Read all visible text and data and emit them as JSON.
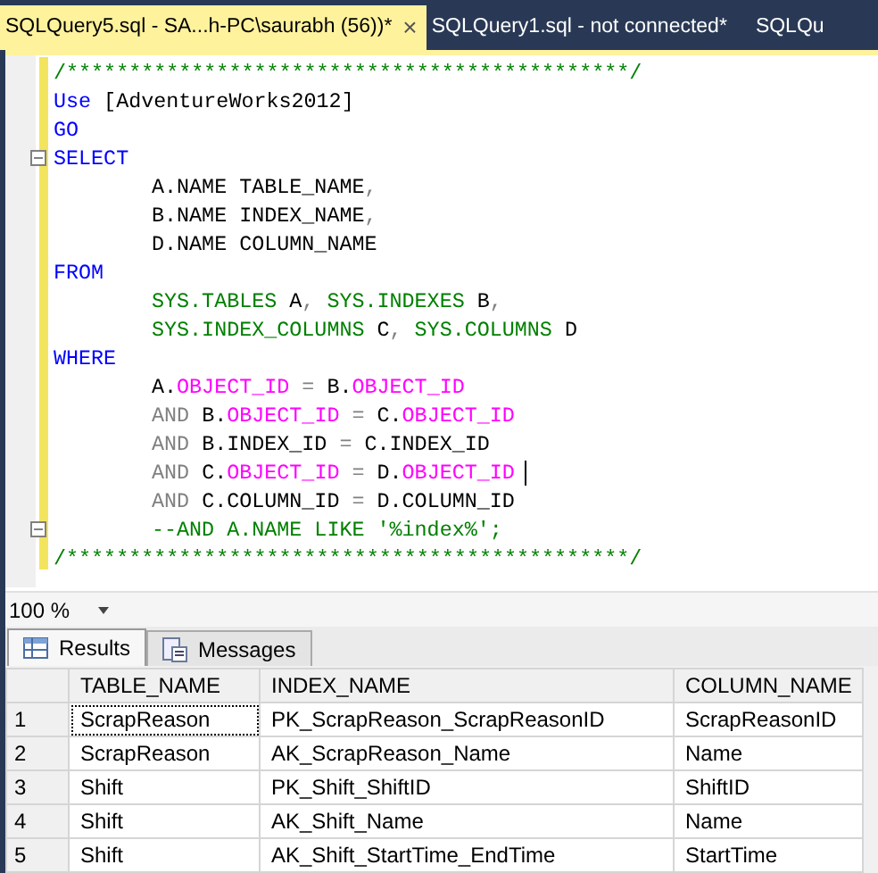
{
  "tabs": [
    {
      "label": "SQLQuery5.sql - SA...h-PC\\saurabh (56))*",
      "selected": true,
      "close": "×"
    },
    {
      "label": "SQLQuery1.sql - not connected*",
      "selected": false
    },
    {
      "label": "SQLQu",
      "selected": false
    }
  ],
  "editor": {
    "lines": [
      {
        "kind": "clause",
        "tokens": [
          {
            "kind": "comment",
            "text": "/*********************************************/"
          }
        ]
      },
      {
        "kind": "clause",
        "tokens": [
          {
            "kind": "keyword",
            "text": "Use"
          },
          {
            "kind": "plain",
            "text": " [AdventureWorks2012]"
          }
        ]
      },
      {
        "kind": "clause",
        "tokens": [
          {
            "kind": "keyword",
            "text": "GO"
          }
        ]
      },
      {
        "kind": "clause",
        "fold_box": true,
        "tokens": [
          {
            "kind": "keyword",
            "text": "SELECT"
          }
        ]
      },
      {
        "kind": "body",
        "tokens": [
          {
            "kind": "plain",
            "text": "A.NAME TABLE_NAME"
          },
          {
            "kind": "operator",
            "text": ","
          }
        ]
      },
      {
        "kind": "body",
        "tokens": [
          {
            "kind": "plain",
            "text": "B.NAME INDEX_NAME"
          },
          {
            "kind": "operator",
            "text": ","
          }
        ]
      },
      {
        "kind": "body",
        "tokens": [
          {
            "kind": "plain",
            "text": "D.NAME COLUMN_NAME"
          }
        ]
      },
      {
        "kind": "clause",
        "tokens": [
          {
            "kind": "keyword",
            "text": "FROM"
          }
        ]
      },
      {
        "kind": "body",
        "tokens": [
          {
            "kind": "system",
            "text": "SYS.TABLES"
          },
          {
            "kind": "plain",
            "text": " A"
          },
          {
            "kind": "operator",
            "text": ","
          },
          {
            "kind": "system",
            "text": " SYS.INDEXES"
          },
          {
            "kind": "plain",
            "text": " B"
          },
          {
            "kind": "operator",
            "text": ","
          }
        ]
      },
      {
        "kind": "body",
        "tokens": [
          {
            "kind": "system",
            "text": "SYS.INDEX_COLUMNS"
          },
          {
            "kind": "plain",
            "text": " C"
          },
          {
            "kind": "operator",
            "text": ","
          },
          {
            "kind": "system",
            "text": " SYS.COLUMNS"
          },
          {
            "kind": "plain",
            "text": " D"
          }
        ]
      },
      {
        "kind": "clause",
        "tokens": [
          {
            "kind": "keyword",
            "text": "WHERE"
          }
        ]
      },
      {
        "kind": "body",
        "tokens": [
          {
            "kind": "plain",
            "text": "A."
          },
          {
            "kind": "function",
            "text": "OBJECT_ID"
          },
          {
            "kind": "operator",
            "text": " = "
          },
          {
            "kind": "plain",
            "text": "B."
          },
          {
            "kind": "function",
            "text": "OBJECT_ID"
          }
        ]
      },
      {
        "kind": "body",
        "tokens": [
          {
            "kind": "operator",
            "text": "AND "
          },
          {
            "kind": "plain",
            "text": "B."
          },
          {
            "kind": "function",
            "text": "OBJECT_ID"
          },
          {
            "kind": "operator",
            "text": " = "
          },
          {
            "kind": "plain",
            "text": "C."
          },
          {
            "kind": "function",
            "text": "OBJECT_ID"
          }
        ]
      },
      {
        "kind": "body",
        "tokens": [
          {
            "kind": "operator",
            "text": "AND "
          },
          {
            "kind": "plain",
            "text": "B.INDEX_ID"
          },
          {
            "kind": "operator",
            "text": " = "
          },
          {
            "kind": "plain",
            "text": "C.INDEX_ID"
          }
        ]
      },
      {
        "kind": "body",
        "caret": true,
        "tokens": [
          {
            "kind": "operator",
            "text": "AND "
          },
          {
            "kind": "plain",
            "text": "C."
          },
          {
            "kind": "function",
            "text": "OBJECT_ID"
          },
          {
            "kind": "operator",
            "text": " = "
          },
          {
            "kind": "plain",
            "text": "D."
          },
          {
            "kind": "function",
            "text": "OBJECT_ID"
          }
        ]
      },
      {
        "kind": "body",
        "tokens": [
          {
            "kind": "operator",
            "text": "AND "
          },
          {
            "kind": "plain",
            "text": "C.COLUMN_ID"
          },
          {
            "kind": "operator",
            "text": " = "
          },
          {
            "kind": "plain",
            "text": "D.COLUMN_ID"
          }
        ]
      },
      {
        "kind": "body",
        "fold_box": true,
        "tokens": [
          {
            "kind": "comment",
            "text": "--AND A.NAME LIKE '%index%';"
          }
        ]
      },
      {
        "kind": "clause",
        "tokens": [
          {
            "kind": "comment",
            "text": "/*********************************************/"
          }
        ]
      }
    ]
  },
  "zoom": "100 %",
  "result_tabs": [
    {
      "label": "Results",
      "selected": true
    },
    {
      "label": "Messages",
      "selected": false
    }
  ],
  "grid": {
    "columns": [
      "TABLE_NAME",
      "INDEX_NAME",
      "COLUMN_NAME"
    ],
    "rows": [
      {
        "number": "1",
        "cells": [
          "ScrapReason",
          "PK_ScrapReason_ScrapReasonID",
          "ScrapReasonID"
        ],
        "focused": true
      },
      {
        "number": "2",
        "cells": [
          "ScrapReason",
          "AK_ScrapReason_Name",
          "Name"
        ],
        "focused": false
      },
      {
        "number": "3",
        "cells": [
          "Shift",
          "PK_Shift_ShiftID",
          "ShiftID"
        ],
        "focused": false
      },
      {
        "number": "4",
        "cells": [
          "Shift",
          "AK_Shift_Name",
          "Name"
        ],
        "focused": false
      },
      {
        "number": "5",
        "cells": [
          "Shift",
          "AK_Shift_StartTime_EndTime",
          "StartTime"
        ],
        "focused": false
      }
    ]
  }
}
